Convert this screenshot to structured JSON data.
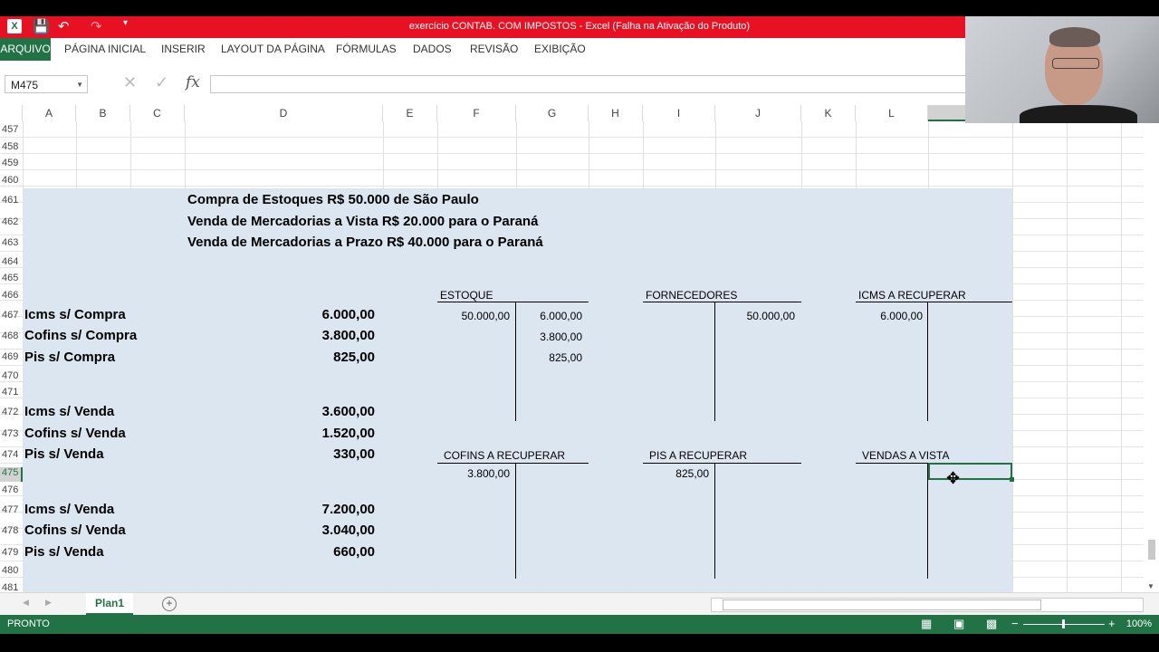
{
  "window": {
    "title": "exercício CONTAB. COM IMPOSTOS -  Excel (Falha na Ativação do Produto)"
  },
  "ribbon": {
    "tabs": [
      "ARQUIVO",
      "PÁGINA INICIAL",
      "INSERIR",
      "LAYOUT DA PÁGINA",
      "FÓRMULAS",
      "DADOS",
      "REVISÃO",
      "EXIBIÇÃO"
    ]
  },
  "formula_bar": {
    "name_box": "M475",
    "fx": "fx",
    "content": ""
  },
  "columns": [
    "A",
    "B",
    "C",
    "D",
    "E",
    "F",
    "G",
    "H",
    "I",
    "J",
    "K",
    "L"
  ],
  "rows": [
    "457",
    "458",
    "459",
    "460",
    "461",
    "462",
    "463",
    "464",
    "465",
    "466",
    "467",
    "468",
    "469",
    "470",
    "471",
    "472",
    "473",
    "474",
    "475",
    "476",
    "477",
    "478",
    "479",
    "480",
    "481"
  ],
  "sheet": {
    "headings": [
      "Compra de Estoques R$ 50.000 de São Paulo",
      "Venda de Mercadorias a Vista R$ 20.000 para o Paraná",
      "Venda de Mercadorias a Prazo R$ 40.000 para o Paraná"
    ],
    "taxes": [
      {
        "label": "Icms s/ Compra",
        "value": "6.000,00"
      },
      {
        "label": "Cofins s/ Compra",
        "value": "3.800,00"
      },
      {
        "label": "Pis s/ Compra",
        "value": "825,00"
      },
      {
        "label": "Icms s/ Venda",
        "value": "3.600,00"
      },
      {
        "label": "Cofins s/ Venda",
        "value": "1.520,00"
      },
      {
        "label": "Pis s/ Venda",
        "value": "330,00"
      },
      {
        "label": "Icms s/ Venda",
        "value": "7.200,00"
      },
      {
        "label": "Cofins s/ Venda",
        "value": "3.040,00"
      },
      {
        "label": "Pis s/ Venda",
        "value": "660,00"
      }
    ],
    "t_accounts": {
      "estoque": {
        "title": "ESTOQUE",
        "debits": [
          "50.000,00"
        ],
        "credits": [
          "6.000,00",
          "3.800,00",
          "825,00"
        ]
      },
      "fornecedores": {
        "title": "FORNECEDORES",
        "credits": [
          "50.000,00"
        ]
      },
      "icms": {
        "title": "ICMS A RECUPERAR",
        "debits": [
          "6.000,00"
        ]
      },
      "cofins": {
        "title": "COFINS A RECUPERAR",
        "debits": [
          "3.800,00"
        ]
      },
      "pis": {
        "title": "PIS A RECUPERAR",
        "debits": [
          "825,00"
        ]
      },
      "vendas": {
        "title": "VENDAS A VISTA"
      }
    }
  },
  "sheet_tabs": {
    "active": "Plan1",
    "add": "+"
  },
  "status": {
    "text": "PRONTO",
    "zoom": "100%"
  },
  "icons": {
    "undo": "undo-icon",
    "redo": "redo-icon",
    "save": "save-icon",
    "cancel": "x-icon",
    "enter": "check-icon"
  }
}
